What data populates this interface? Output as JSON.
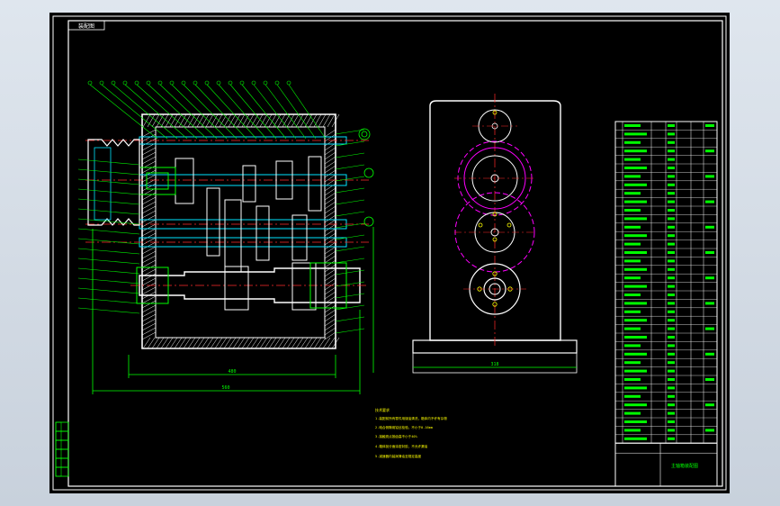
{
  "drawing": {
    "title_stamp": "装配图",
    "layers": {
      "frame": "#ffffff",
      "outline": "#ffffff",
      "hidden": "#00e5ff",
      "center": "#ff2a2a",
      "gear_pitch": "#ff00ff",
      "dimension": "#00ff00",
      "leader": "#00ff00",
      "hatch": "#ffffff"
    },
    "tech_notes": {
      "heading": "技术要求",
      "lines": [
        "1.装配前所有零件用煤油清洗，箱体内不许有杂物",
        "2.啮合侧隙用铅丝检验，不小于0.16mm",
        "3.接触斑点按齿高不小于40%",
        "4.箱体剖分面涂密封胶，不允许漏油",
        "5.减速器内装润滑油至规定高度"
      ]
    },
    "dimension_texts": {
      "inner_width": "480",
      "overall_width": "560",
      "base_width": "318"
    },
    "bom_title": "主轴箱装配图",
    "bom_rows": 38,
    "left_stamp_rows": 6
  }
}
